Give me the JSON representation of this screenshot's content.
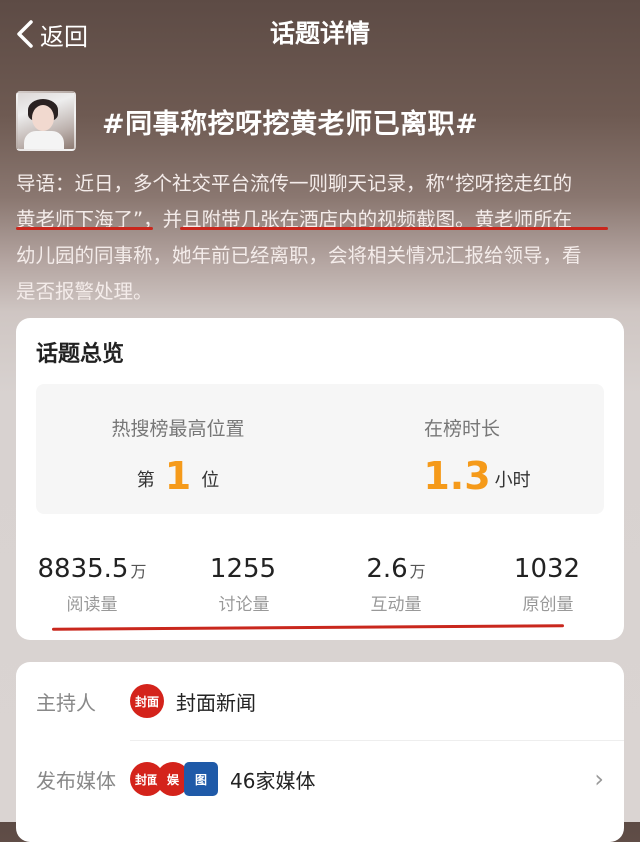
{
  "nav": {
    "back_label": "返回",
    "title": "话题详情"
  },
  "topic": {
    "title": "#同事称挖呀挖黄老师已离职#"
  },
  "intro": {
    "lines": [
      "导语：近日，多个社交平台流传一则聊天记录，称“挖呀挖走红的",
      "黄老师下海了”，并且附带几张在酒店内的视频截图。黄老师所在",
      "幼儿园的同事称，她年前已经离职，会将相关情况汇报给领导，看",
      "是否报警处理。"
    ]
  },
  "overview": {
    "title": "话题总览",
    "hot_rank": {
      "label": "热搜榜最高位置",
      "prefix": "第",
      "value": "1",
      "suffix": "位"
    },
    "duration": {
      "label": "在榜时长",
      "value": "1.3",
      "unit": "小时"
    },
    "stats": [
      {
        "value": "8835.5",
        "unit": "万",
        "label": "阅读量"
      },
      {
        "value": "1255",
        "unit": "",
        "label": "讨论量"
      },
      {
        "value": "2.6",
        "unit": "万",
        "label": "互动量"
      },
      {
        "value": "1032",
        "unit": "",
        "label": "原创量"
      }
    ]
  },
  "info": {
    "host": {
      "key": "主持人",
      "logo_text": "封面",
      "name": "封面新闻"
    },
    "media": {
      "key": "发布媒体",
      "logos": [
        "封面",
        "娱",
        "图"
      ],
      "name": "46家媒体"
    }
  },
  "colors": {
    "accent_orange": "#f59a1a",
    "underline_red": "#c9271d",
    "logo_red": "#d4231b"
  }
}
